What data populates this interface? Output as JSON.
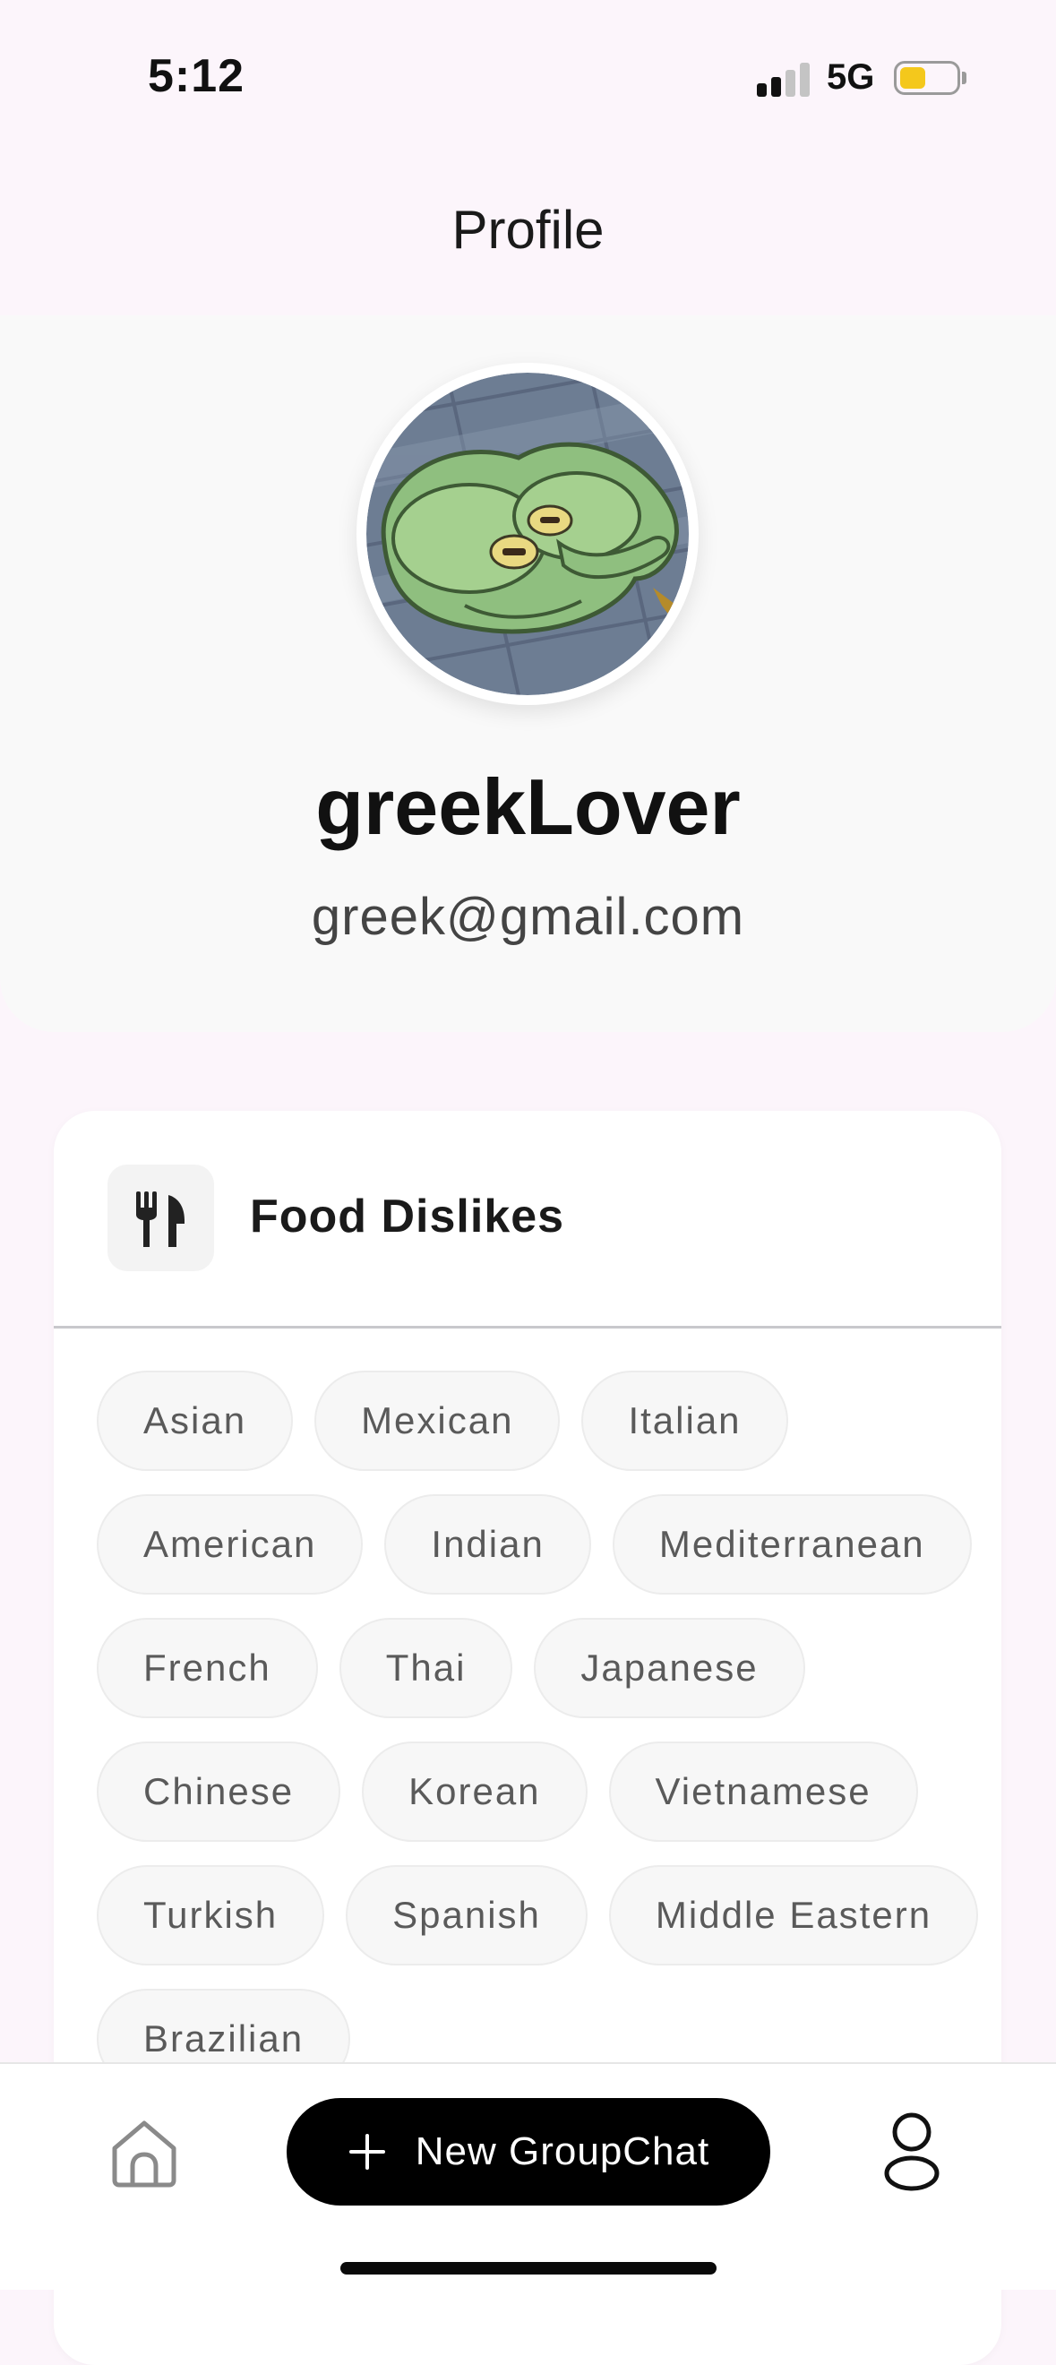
{
  "status_bar": {
    "time": "5:12",
    "network": "5G",
    "battery_level": 0.45,
    "signal_bars_active": 2,
    "battery_color": "#f4c81c"
  },
  "header": {
    "title": "Profile"
  },
  "profile": {
    "username": "greekLover",
    "email": "greek@gmail.com",
    "avatar_icon": "avatar-photo"
  },
  "food_dislikes": {
    "icon": "fork-knife-icon",
    "title": "Food Dislikes",
    "items": [
      "Asian",
      "Mexican",
      "Italian",
      "American",
      "Indian",
      "Mediterranean",
      "French",
      "Thai",
      "Japanese",
      "Chinese",
      "Korean",
      "Vietnamese",
      "Turkish",
      "Spanish",
      "Middle Eastern",
      "Brazilian"
    ]
  },
  "bottom_nav": {
    "home_icon": "home-icon",
    "new_chat_label": "New GroupChat",
    "new_chat_icon": "plus-icon",
    "profile_icon": "user-icon"
  },
  "colors": {
    "background": "#fcf5fb",
    "button": "#000000",
    "chip_bg": "#f7f7f7"
  }
}
